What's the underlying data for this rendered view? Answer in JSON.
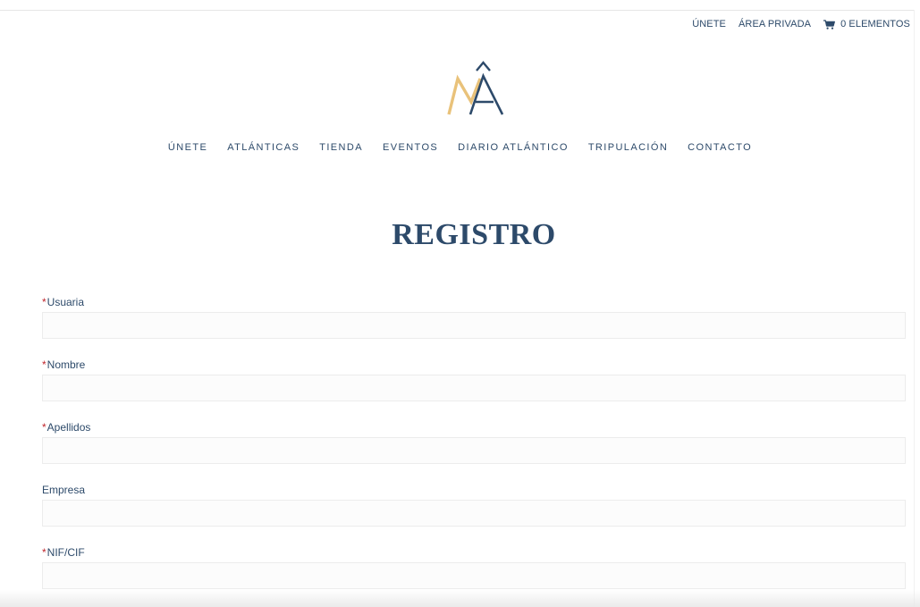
{
  "utility_nav": {
    "join_label": "ÚNETE",
    "private_area_label": "ÁREA PRIVADA",
    "cart_label": "0 ELEMENTOS",
    "cart_icon": "shopping-cart-icon"
  },
  "logo": {
    "letters": "MÂ",
    "colors": {
      "m": "#e9c27a",
      "a": "#2d4a6a"
    }
  },
  "main_nav": {
    "items": [
      {
        "label": "ÚNETE"
      },
      {
        "label": "ATLÁNTICAS"
      },
      {
        "label": "TIENDA"
      },
      {
        "label": "EVENTOS"
      },
      {
        "label": "DIARIO ATLÁNTICO"
      },
      {
        "label": "TRIPULACIÓN"
      },
      {
        "label": "CONTACTO"
      }
    ]
  },
  "page": {
    "title": "REGISTRO"
  },
  "form": {
    "required_marker": "*",
    "fields": [
      {
        "label": "Usuaria",
        "required": true,
        "value": ""
      },
      {
        "label": "Nombre",
        "required": true,
        "value": ""
      },
      {
        "label": "Apellidos",
        "required": true,
        "value": ""
      },
      {
        "label": "Empresa",
        "required": false,
        "value": ""
      },
      {
        "label": "NIF/CIF",
        "required": true,
        "value": ""
      }
    ]
  },
  "colors": {
    "brand_navy": "#2d4a6a",
    "brand_gold": "#e9c27a",
    "required_red": "#c0262d",
    "input_border": "#ececec"
  }
}
